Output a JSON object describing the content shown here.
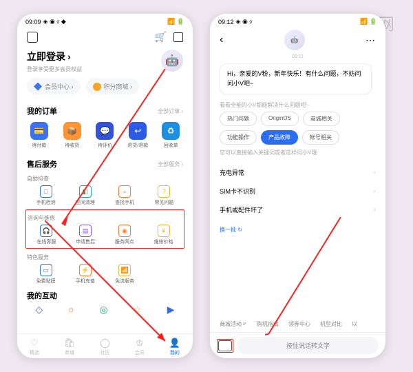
{
  "watermark": "爱创根知识网",
  "phone1": {
    "status": {
      "time": "09:09",
      "icons": "◈ ◉ ⬨ ◆"
    },
    "login": {
      "title": "立即登录",
      "arrow": "›",
      "sub": "登录享受更多会员权益"
    },
    "pills": [
      {
        "label": "会员中心 ›",
        "color": "#3a72f0"
      },
      {
        "label": "积分商城 ›",
        "color": "#f5a623"
      }
    ],
    "orders": {
      "title": "我的订单",
      "more": "全部订单 ›",
      "items": [
        {
          "label": "待付款",
          "bg": "#3a72f0"
        },
        {
          "label": "待收货",
          "bg": "#ff9432"
        },
        {
          "label": "待评价",
          "bg": "#3452d8"
        },
        {
          "label": "退货/退款",
          "bg": "#2b5ce8"
        },
        {
          "label": "回收单",
          "bg": "#1d8fe0"
        }
      ]
    },
    "aftersale": {
      "title": "售后服务",
      "more": "全部服务 ›",
      "groups": [
        {
          "title": "自助排查",
          "items": [
            {
              "label": "手机检测",
              "color": "#2c6ef2"
            },
            {
              "label": "空间清理",
              "color": "#1cb07a"
            },
            {
              "label": "查找手机",
              "color": "#ff7a2e"
            },
            {
              "label": "常见问题",
              "color": "#f5b82e"
            }
          ]
        },
        {
          "title": "咨询与维修",
          "items": [
            {
              "label": "在线客服",
              "color": "#2c6ef2"
            },
            {
              "label": "申请售后",
              "color": "#8a52e8"
            },
            {
              "label": "服务网点",
              "color": "#ff7a2e"
            },
            {
              "label": "维修价格",
              "color": "#f5b82e"
            }
          ]
        },
        {
          "title": "特色服务",
          "items": [
            {
              "label": "免费贴膜",
              "color": "#2c6ef2"
            },
            {
              "label": "手机充值",
              "color": "#ff7a2e"
            },
            {
              "label": "免流服务",
              "color": "#f5b82e"
            }
          ]
        }
      ]
    },
    "interact": {
      "title": "我的互动"
    },
    "nav": [
      {
        "label": "精选"
      },
      {
        "label": "商城"
      },
      {
        "label": "社区"
      },
      {
        "label": "会员"
      },
      {
        "label": "我的",
        "active": true
      }
    ]
  },
  "phone2": {
    "status": {
      "time": "09:12"
    },
    "chat_time": "09:11",
    "greeting": "Hi，亲爱的V粉，新年快乐！有什么问题，不妨问问小V吧~",
    "hint1": "看看全能的小V都能解决什么问题吧~",
    "chips": [
      {
        "label": "热门问题"
      },
      {
        "label": "OriginOS"
      },
      {
        "label": "商城相关"
      },
      {
        "label": "功能操作"
      },
      {
        "label": "产品故障",
        "active": true
      },
      {
        "label": "帐号相关"
      }
    ],
    "hint2": "您可以直接输入关键词或者这样问小V哦",
    "faqs": [
      "充电异常",
      "SIM卡不识别",
      "手机或配件坏了"
    ],
    "refresh": "换一批 ↻",
    "quick": [
      "商城活动〃",
      "购机指南",
      "领券中心",
      "机型对比",
      "以"
    ],
    "voice": "按住说话转文字"
  }
}
